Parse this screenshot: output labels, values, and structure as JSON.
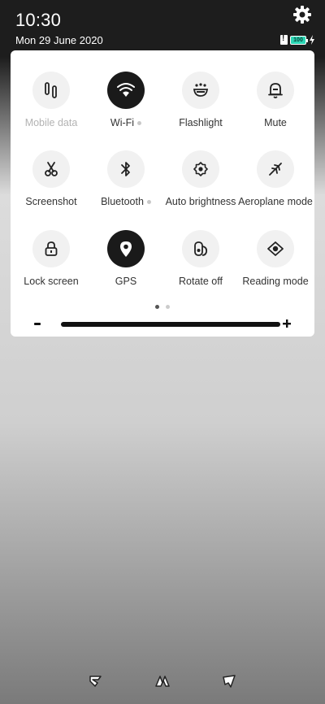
{
  "status": {
    "time": "10:30",
    "date": "Mon 29 June 2020",
    "battery_level": "100",
    "accent": "#2bd6b4"
  },
  "quick_settings": {
    "tiles": [
      {
        "label": "Mobile data",
        "icon": "mobile-data-icon",
        "active": false,
        "disabled": true
      },
      {
        "label": "Wi-Fi",
        "icon": "wifi-icon",
        "active": true,
        "expandable": true
      },
      {
        "label": "Flashlight",
        "icon": "flashlight-icon",
        "active": false
      },
      {
        "label": "Mute",
        "icon": "bell-icon",
        "active": false
      },
      {
        "label": "Screenshot",
        "icon": "scissors-icon",
        "active": false
      },
      {
        "label": "Bluetooth",
        "icon": "bluetooth-icon",
        "active": false,
        "expandable": true
      },
      {
        "label": "Auto brightness",
        "icon": "brightness-icon",
        "active": false
      },
      {
        "label": "Aeroplane mode",
        "icon": "airplane-icon",
        "active": false
      },
      {
        "label": "Lock screen",
        "icon": "lock-icon",
        "active": false
      },
      {
        "label": "GPS",
        "icon": "location-pin-icon",
        "active": true
      },
      {
        "label": "Rotate off",
        "icon": "rotate-lock-icon",
        "active": false
      },
      {
        "label": "Reading mode",
        "icon": "eye-icon",
        "active": false
      }
    ],
    "page_count": 2,
    "current_page": 1,
    "brightness_level": 1.0
  },
  "navbar": {
    "buttons": [
      "menu-gesture-icon",
      "home-gesture-icon",
      "back-gesture-icon"
    ]
  }
}
